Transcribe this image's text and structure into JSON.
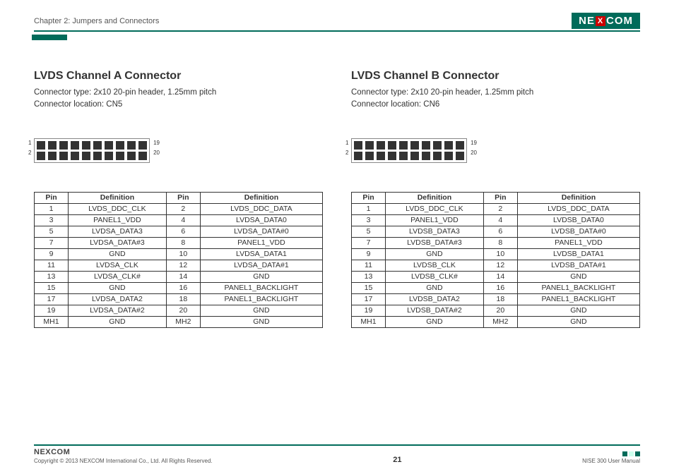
{
  "header": {
    "chapter": "Chapter 2: Jumpers and Connectors",
    "brand_before": "NE",
    "brand_x": "X",
    "brand_after": "COM"
  },
  "sections": {
    "a": {
      "title": "LVDS Channel A Connector",
      "conn_type": "Connector type: 2x10 20-pin header, 1.25mm pitch",
      "conn_loc": "Connector location: CN5",
      "table_headers": {
        "pin": "Pin",
        "def": "Definition"
      },
      "rows": [
        {
          "p1": "1",
          "d1": "LVDS_DDC_CLK",
          "p2": "2",
          "d2": "LVDS_DDC_DATA"
        },
        {
          "p1": "3",
          "d1": "PANEL1_VDD",
          "p2": "4",
          "d2": "LVDSA_DATA0"
        },
        {
          "p1": "5",
          "d1": "LVDSA_DATA3",
          "p2": "6",
          "d2": "LVDSA_DATA#0"
        },
        {
          "p1": "7",
          "d1": "LVDSA_DATA#3",
          "p2": "8",
          "d2": "PANEL1_VDD"
        },
        {
          "p1": "9",
          "d1": "GND",
          "p2": "10",
          "d2": "LVDSA_DATA1"
        },
        {
          "p1": "11",
          "d1": "LVDSA_CLK",
          "p2": "12",
          "d2": "LVDSA_DATA#1"
        },
        {
          "p1": "13",
          "d1": "LVDSA_CLK#",
          "p2": "14",
          "d2": "GND"
        },
        {
          "p1": "15",
          "d1": "GND",
          "p2": "16",
          "d2": "PANEL1_BACKLIGHT"
        },
        {
          "p1": "17",
          "d1": "LVDSA_DATA2",
          "p2": "18",
          "d2": "PANEL1_BACKLIGHT"
        },
        {
          "p1": "19",
          "d1": "LVDSA_DATA#2",
          "p2": "20",
          "d2": "GND"
        },
        {
          "p1": "MH1",
          "d1": "GND",
          "p2": "MH2",
          "d2": "GND"
        }
      ]
    },
    "b": {
      "title": "LVDS Channel B Connector",
      "conn_type": "Connector type: 2x10 20-pin header, 1.25mm pitch",
      "conn_loc": "Connector location: CN6",
      "table_headers": {
        "pin": "Pin",
        "def": "Definition"
      },
      "rows": [
        {
          "p1": "1",
          "d1": "LVDS_DDC_CLK",
          "p2": "2",
          "d2": "LVDS_DDC_DATA"
        },
        {
          "p1": "3",
          "d1": "PANEL1_VDD",
          "p2": "4",
          "d2": "LVDSB_DATA0"
        },
        {
          "p1": "5",
          "d1": "LVDSB_DATA3",
          "p2": "6",
          "d2": "LVDSB_DATA#0"
        },
        {
          "p1": "7",
          "d1": "LVDSB_DATA#3",
          "p2": "8",
          "d2": "PANEL1_VDD"
        },
        {
          "p1": "9",
          "d1": "GND",
          "p2": "10",
          "d2": "LVDSB_DATA1"
        },
        {
          "p1": "11",
          "d1": "LVDSB_CLK",
          "p2": "12",
          "d2": "LVDSB_DATA#1"
        },
        {
          "p1": "13",
          "d1": "LVDSB_CLK#",
          "p2": "14",
          "d2": "GND"
        },
        {
          "p1": "15",
          "d1": "GND",
          "p2": "16",
          "d2": "PANEL1_BACKLIGHT"
        },
        {
          "p1": "17",
          "d1": "LVDSB_DATA2",
          "p2": "18",
          "d2": "PANEL1_BACKLIGHT"
        },
        {
          "p1": "19",
          "d1": "LVDSB_DATA#2",
          "p2": "20",
          "d2": "GND"
        },
        {
          "p1": "MH1",
          "d1": "GND",
          "p2": "MH2",
          "d2": "GND"
        }
      ]
    }
  },
  "diagram_labels": {
    "l1": "1",
    "l2": "2",
    "l19": "19",
    "l20": "20"
  },
  "footer": {
    "brand": "NEXCOM",
    "copyright": "Copyright © 2013 NEXCOM International Co., Ltd. All Rights Reserved.",
    "page": "21",
    "manual": "NISE 300 User Manual"
  }
}
